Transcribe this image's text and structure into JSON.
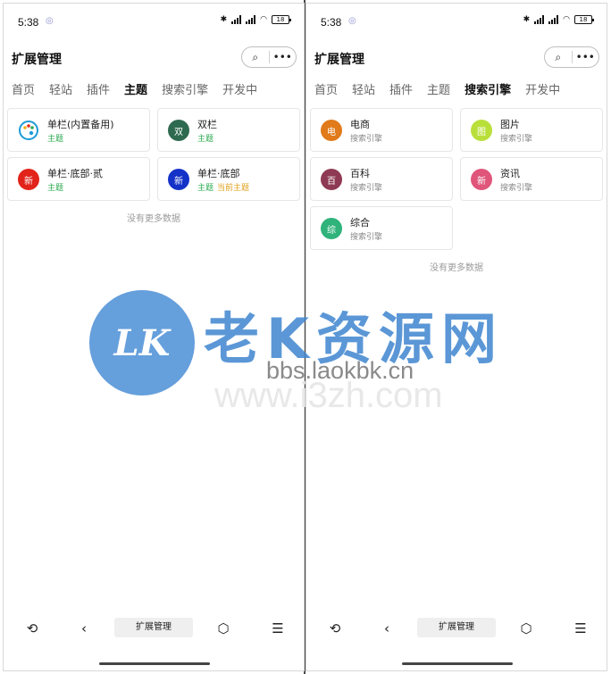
{
  "left": {
    "status": {
      "time": "5:38",
      "battery": "18"
    },
    "header": {
      "title": "扩展管理"
    },
    "tabs": [
      "首页",
      "轻站",
      "插件",
      "主题",
      "搜索引擎",
      "开发中"
    ],
    "active_tab": "主题",
    "cards": [
      {
        "title": "单栏(内置备用)",
        "subtitle": "主题",
        "icon": "palette-icon",
        "avatar_text": "",
        "color": "#1e9bd7"
      },
      {
        "title": "双栏",
        "subtitle": "主题",
        "avatar_text": "双",
        "color": "#2e6a4f"
      },
      {
        "title": "单栏·底部·贰",
        "subtitle": "主题",
        "avatar_text": "新",
        "color": "#e2231a"
      },
      {
        "title": "单栏·底部",
        "subtitle": "主题",
        "tag": "当前主题",
        "avatar_text": "新",
        "color": "#1432c8"
      }
    ],
    "no_more": "没有更多数据",
    "nav": {
      "label": "扩展管理"
    }
  },
  "right": {
    "status": {
      "time": "5:38",
      "battery": "18"
    },
    "header": {
      "title": "扩展管理"
    },
    "tabs": [
      "首页",
      "轻站",
      "插件",
      "主题",
      "搜索引擎",
      "开发中"
    ],
    "active_tab": "搜索引擎",
    "cards": [
      {
        "title": "电商",
        "subtitle": "搜索引擎",
        "avatar_text": "电",
        "color": "#e07a1a"
      },
      {
        "title": "图片",
        "subtitle": "搜索引擎",
        "avatar_text": "图",
        "color": "#b9df3a"
      },
      {
        "title": "百科",
        "subtitle": "搜索引擎",
        "avatar_text": "百",
        "color": "#8e3a54"
      },
      {
        "title": "资讯",
        "subtitle": "搜索引擎",
        "avatar_text": "新",
        "color": "#e0557a"
      },
      {
        "title": "综合",
        "subtitle": "搜索引擎",
        "avatar_text": "综",
        "color": "#2fb37a"
      }
    ],
    "no_more": "没有更多数据",
    "nav": {
      "label": "扩展管理"
    }
  },
  "watermark": {
    "badge": "LK",
    "text": "老K资源网",
    "url": "bbs.laokbk.cn",
    "url2": "www.i3zh.com"
  }
}
